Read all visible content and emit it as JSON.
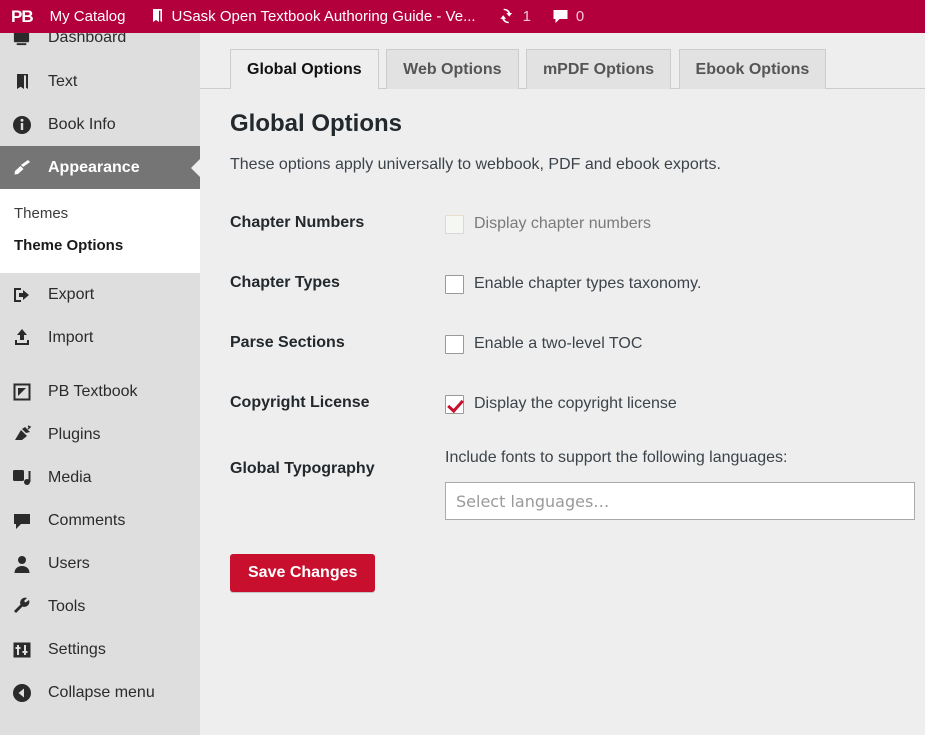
{
  "adminbar": {
    "logo": "PB",
    "logo_icon": "pressbooks-logo-icon",
    "catalog_label": "My Catalog",
    "book_icon": "book-icon",
    "book_title": "USask Open Textbook Authoring Guide - Ve...",
    "updates_icon": "update-refresh-icon",
    "updates_count": "1",
    "comments_icon": "comment-bubble-icon",
    "comments_count": "0"
  },
  "sidebar": {
    "items": [
      {
        "label": "Dashboard",
        "icon": "dashboard-icon",
        "state": "clipped"
      },
      {
        "label": "Text",
        "icon": "book-icon",
        "state": "normal"
      },
      {
        "label": "Book Info",
        "icon": "info-circle-icon",
        "state": "normal"
      },
      {
        "label": "Appearance",
        "icon": "paintbrush-icon",
        "state": "current"
      },
      {
        "label": "Export",
        "icon": "export-arrow-icon",
        "state": "normal"
      },
      {
        "label": "Import",
        "icon": "import-arrow-icon",
        "state": "normal"
      },
      {
        "label": "PB Textbook",
        "icon": "textbook-icon",
        "state": "normal"
      },
      {
        "label": "Plugins",
        "icon": "plug-icon",
        "state": "normal"
      },
      {
        "label": "Media",
        "icon": "media-icon",
        "state": "normal"
      },
      {
        "label": "Comments",
        "icon": "comment-bubble-icon",
        "state": "normal"
      },
      {
        "label": "Users",
        "icon": "user-icon",
        "state": "normal"
      },
      {
        "label": "Tools",
        "icon": "wrench-icon",
        "state": "normal"
      },
      {
        "label": "Settings",
        "icon": "sliders-icon",
        "state": "normal"
      },
      {
        "label": "Collapse menu",
        "icon": "collapse-arrow-icon",
        "state": "normal"
      }
    ],
    "submenu": [
      {
        "label": "Themes",
        "current": false
      },
      {
        "label": "Theme Options",
        "current": true
      }
    ]
  },
  "tabs": [
    {
      "label": "Global Options",
      "active": true
    },
    {
      "label": "Web Options",
      "active": false
    },
    {
      "label": "mPDF Options",
      "active": false
    },
    {
      "label": "Ebook Options",
      "active": false
    }
  ],
  "main": {
    "title": "Global Options",
    "description": "These options apply universally to webbook, PDF and ebook exports.",
    "rows": [
      {
        "label": "Chapter Numbers",
        "checkbox_label": "Display chapter numbers",
        "checked": false,
        "disabled": true
      },
      {
        "label": "Chapter Types",
        "checkbox_label": "Enable chapter types taxonomy.",
        "checked": false,
        "disabled": false
      },
      {
        "label": "Parse Sections",
        "checkbox_label": "Enable a two-level TOC",
        "checked": false,
        "disabled": false
      },
      {
        "label": "Copyright License",
        "checkbox_label": "Display the copyright license",
        "checked": true,
        "disabled": false
      }
    ],
    "typography": {
      "label": "Global Typography",
      "heading": "Include fonts to support the following languages:",
      "select_placeholder": "Select languages…"
    },
    "save_label": "Save Changes"
  },
  "colors": {
    "brand_red": "#b3003c",
    "button_red": "#c8102e",
    "sidebar_bg": "#dedede",
    "current_item_bg": "#757575",
    "content_bg": "#eeeeee"
  }
}
